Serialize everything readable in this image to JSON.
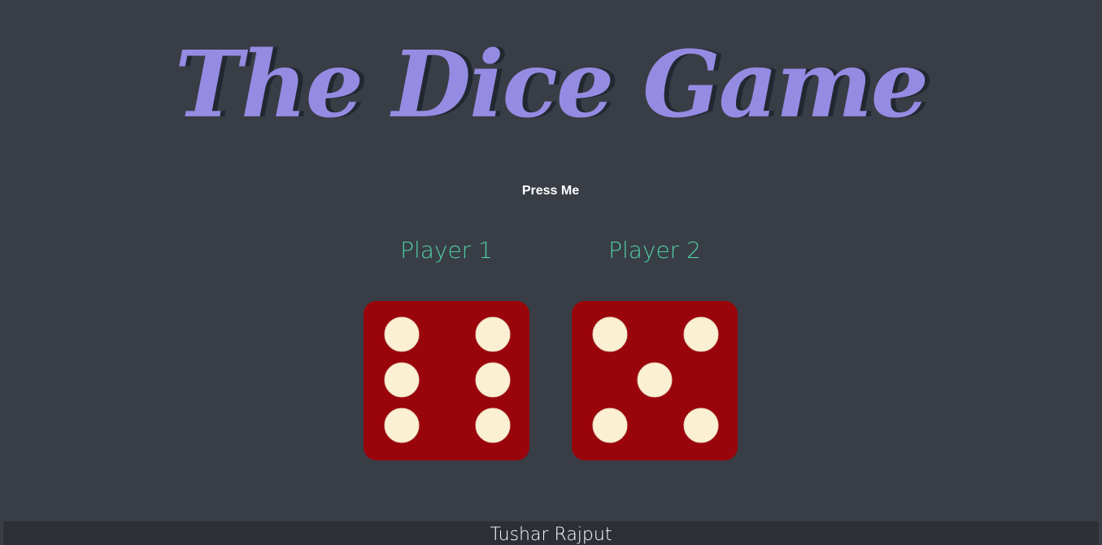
{
  "title": "The Dice Game",
  "button": {
    "label": "Press Me"
  },
  "players": [
    {
      "label": "Player 1",
      "dice_value": 6
    },
    {
      "label": "Player 2",
      "dice_value": 5
    }
  ],
  "footer": {
    "text": "Tushar Rajput"
  },
  "colors": {
    "background": "#393e46",
    "title": "#968be3",
    "player_label": "#4ecca3",
    "dice_face": "#9a050b",
    "dice_pip": "#fbefd4",
    "footer_bg": "#2c3036"
  }
}
